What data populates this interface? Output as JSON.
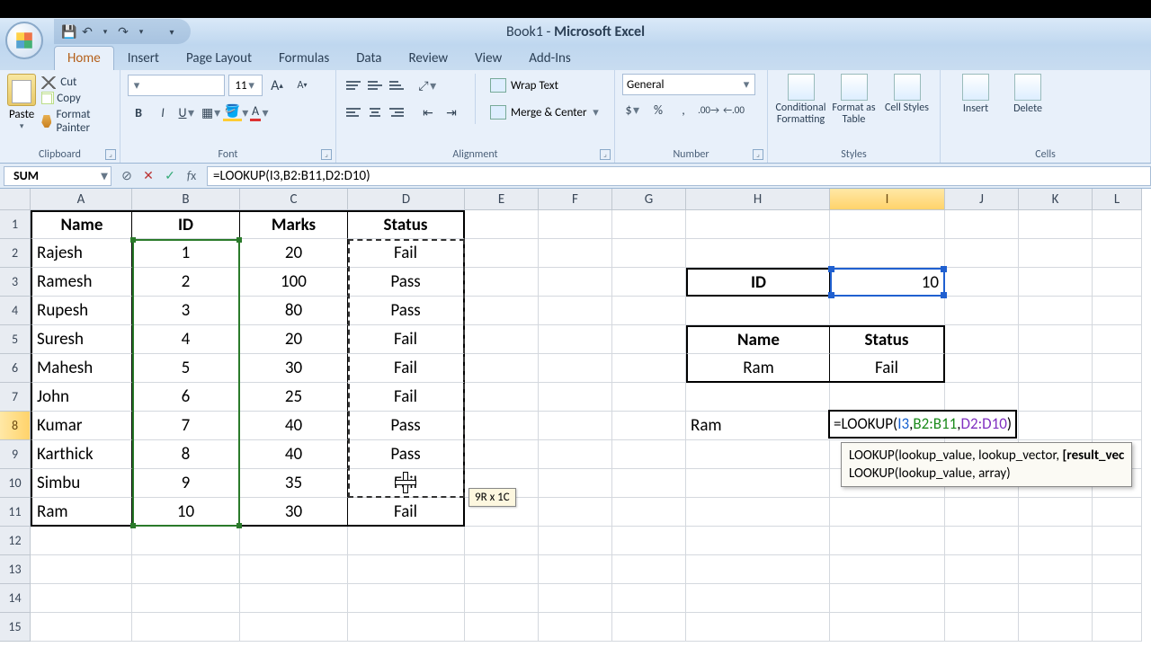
{
  "app_title_doc": "Book1",
  "app_title_app": "Microsoft Excel",
  "tabs": [
    "Home",
    "Insert",
    "Page Layout",
    "Formulas",
    "Data",
    "Review",
    "View",
    "Add-Ins"
  ],
  "active_tab": "Home",
  "clipboard": {
    "paste": "Paste",
    "cut": "Cut",
    "copy": "Copy",
    "painter": "Format Painter",
    "group": "Clipboard"
  },
  "font": {
    "size": "11",
    "group": "Font",
    "bold": "B",
    "italic": "I",
    "underline": "U"
  },
  "alignment": {
    "wrap": "Wrap Text",
    "merge": "Merge & Center",
    "group": "Alignment"
  },
  "number": {
    "format": "General",
    "group": "Number"
  },
  "styles": {
    "cond": "Conditional Formatting",
    "table": "Format as Table",
    "cell": "Cell Styles",
    "group": "Styles"
  },
  "cells": {
    "insert": "Insert",
    "delete": "Delete",
    "group": "Cells"
  },
  "namebox": "SUM",
  "formula_bar": "=LOOKUP(I3,B2:B11,D2:D10)",
  "columns": [
    "A",
    "B",
    "C",
    "D",
    "E",
    "F",
    "G",
    "H",
    "I",
    "J",
    "K",
    "L"
  ],
  "col_widths": {
    "A": 113,
    "B": 120,
    "C": 120,
    "D": 130,
    "E": 82,
    "F": 82,
    "G": 82,
    "H": 160,
    "I": 128,
    "J": 82,
    "K": 82,
    "L": 55
  },
  "rows": [
    "1",
    "2",
    "3",
    "4",
    "5",
    "6",
    "7",
    "8",
    "9",
    "10",
    "11",
    "12",
    "13",
    "14",
    "15"
  ],
  "selected_col": "I",
  "selected_row": "8",
  "table": {
    "headers": {
      "A": "Name",
      "B": "ID",
      "C": "Marks",
      "D": "Status"
    },
    "data": [
      {
        "name": "Rajesh",
        "id": "1",
        "marks": "20",
        "status": "Fail"
      },
      {
        "name": "Ramesh",
        "id": "2",
        "marks": "100",
        "status": "Pass"
      },
      {
        "name": "Rupesh",
        "id": "3",
        "marks": "80",
        "status": "Pass"
      },
      {
        "name": "Suresh",
        "id": "4",
        "marks": "20",
        "status": "Fail"
      },
      {
        "name": "Mahesh",
        "id": "5",
        "marks": "30",
        "status": "Fail"
      },
      {
        "name": "John",
        "id": "6",
        "marks": "25",
        "status": "Fail"
      },
      {
        "name": "Kumar",
        "id": "7",
        "marks": "40",
        "status": "Pass"
      },
      {
        "name": "Karthick",
        "id": "8",
        "marks": "40",
        "status": "Pass"
      },
      {
        "name": "Simbu",
        "id": "9",
        "marks": "35",
        "status": "Fail"
      },
      {
        "name": "Ram",
        "id": "10",
        "marks": "30",
        "status": "Fail"
      }
    ]
  },
  "lookup_box": {
    "h3_label": "ID",
    "i3_value": "10",
    "h5_label": "Name",
    "i5_label": "Status",
    "h6_value": "Ram",
    "i6_value": "Fail",
    "h8_value": "Ram"
  },
  "editing_cell": {
    "prefix": "=LOOKUP(",
    "arg1": "I3",
    "c1": ",",
    "arg2": "B2:B11",
    "c2": ",",
    "arg3": "D2:D10",
    "suffix": ")"
  },
  "fn_tooltip": {
    "line1_a": "LOOKUP(lookup_value, lookup_vector, ",
    "line1_b": "[result_vec",
    "line2": "LOOKUP(lookup_value, array)"
  },
  "size_tip": "9R x 1C",
  "chart_data": {
    "type": "table",
    "title": "",
    "columns": [
      "Name",
      "ID",
      "Marks",
      "Status"
    ],
    "rows": [
      [
        "Rajesh",
        1,
        20,
        "Fail"
      ],
      [
        "Ramesh",
        2,
        100,
        "Pass"
      ],
      [
        "Rupesh",
        3,
        80,
        "Pass"
      ],
      [
        "Suresh",
        4,
        20,
        "Fail"
      ],
      [
        "Mahesh",
        5,
        30,
        "Fail"
      ],
      [
        "John",
        6,
        25,
        "Fail"
      ],
      [
        "Kumar",
        7,
        40,
        "Pass"
      ],
      [
        "Karthick",
        8,
        40,
        "Pass"
      ],
      [
        "Simbu",
        9,
        35,
        "Fail"
      ],
      [
        "Ram",
        10,
        30,
        "Fail"
      ]
    ]
  }
}
